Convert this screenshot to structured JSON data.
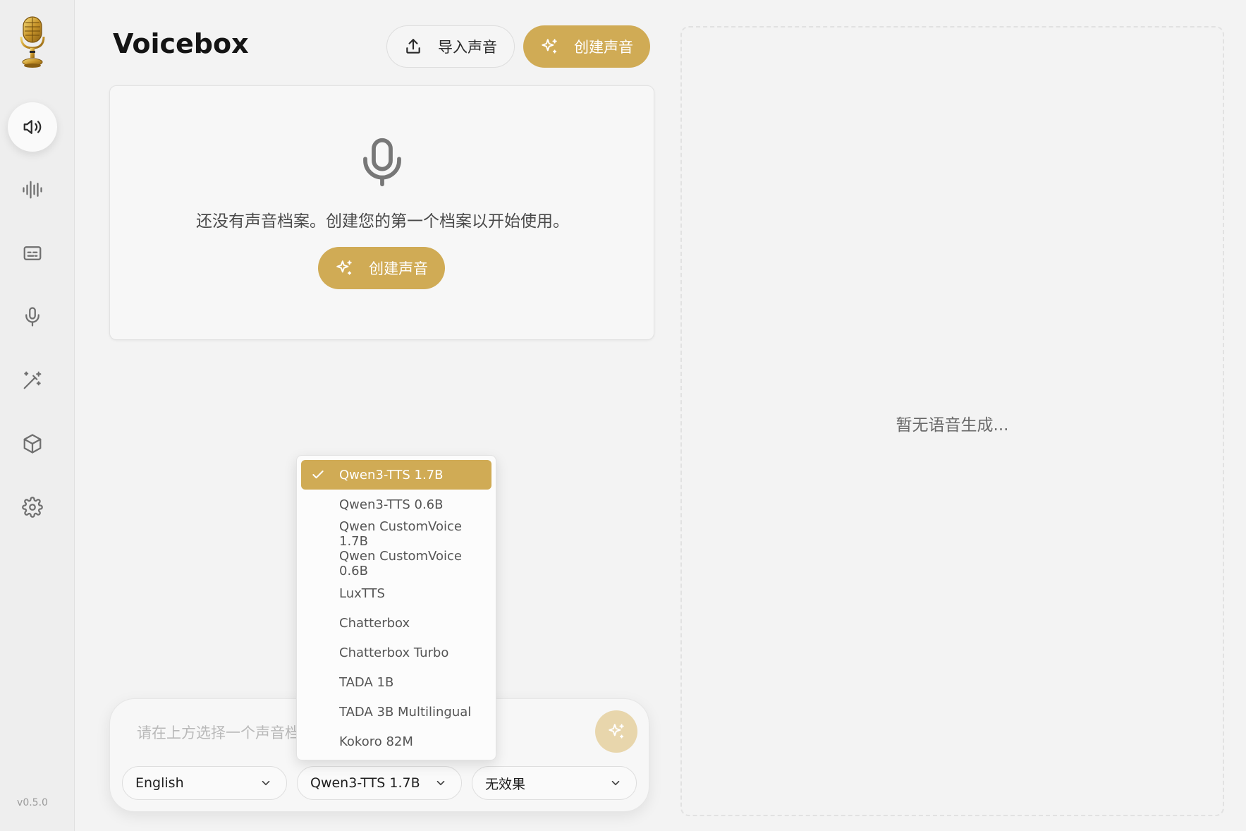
{
  "app": {
    "title": "Voicebox",
    "version": "v0.5.0"
  },
  "header": {
    "import_label": "导入声音",
    "create_label": "创建声音"
  },
  "empty_state": {
    "message": "还没有声音档案。创建您的第一个档案以开始使用。",
    "create_label": "创建声音"
  },
  "history": {
    "empty_message": "暂无语音生成..."
  },
  "composer": {
    "placeholder": "请在上方选择一个声音档案...",
    "language": "English",
    "model": "Qwen3-TTS 1.7B",
    "effect": "无效果"
  },
  "model_menu": {
    "selected": "Qwen3-TTS 1.7B",
    "options": [
      "Qwen3-TTS 1.7B",
      "Qwen3-TTS 0.6B",
      "Qwen CustomVoice 1.7B",
      "Qwen CustomVoice 0.6B",
      "LuxTTS",
      "Chatterbox",
      "Chatterbox Turbo",
      "TADA 1B",
      "TADA 3B Multilingual",
      "Kokoro 82M"
    ]
  },
  "colors": {
    "accent": "#d0ab55",
    "accent_light": "#e8d6ac",
    "background": "#f3f3f3",
    "sidebar": "#eeeeee"
  },
  "icons": {
    "nav": [
      "speaker-icon",
      "waveform-icon",
      "captions-icon",
      "microphone-icon",
      "magic-wand-icon",
      "box-icon",
      "gear-icon"
    ]
  }
}
